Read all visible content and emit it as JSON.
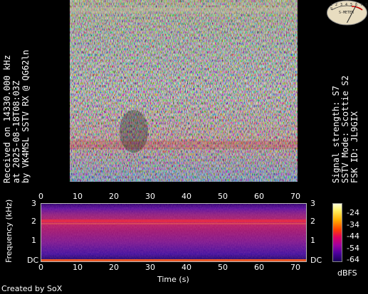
{
  "left_caption": {
    "line1": "Received on  14330.000 kHz",
    "line2": "at 2025-08-18T08:03Z",
    "line3": "by VK4MSL SSTV RX @ QG62ln"
  },
  "right_caption": {
    "line1": "Signal strength: S7",
    "line2": "SSTV Mode: Scottie S2",
    "line3": "FSK ID: JL9GIX"
  },
  "meter": {
    "scale_text": "1 2 3 4 5 6 7 8 9",
    "unit_text": "S-METER"
  },
  "spectrogram": {
    "x_axis_title": "Time (s)",
    "y_axis_title": "Frequency (kHz)",
    "x_ticks": [
      "0",
      "10",
      "20",
      "30",
      "40",
      "50",
      "60",
      "70"
    ],
    "y_ticks_left": [
      "3",
      "2",
      "1",
      "DC"
    ],
    "y_ticks_right": [
      "3",
      "2",
      "1",
      "DC"
    ],
    "colorbar_ticks": [
      "-24",
      "-34",
      "-44",
      "-54",
      "-64"
    ],
    "colorbar_unit": "dBFS"
  },
  "footer": {
    "credit": "Created by SoX"
  }
}
